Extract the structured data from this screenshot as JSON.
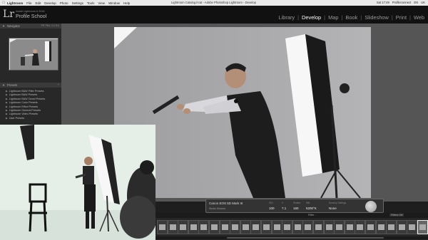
{
  "menubar": {
    "apple_icon": "apple-icon",
    "app_name": "Lightroom",
    "menus": [
      "File",
      "Edit",
      "Develop",
      "Photo",
      "Settings",
      "Tools",
      "View",
      "Window",
      "Help"
    ],
    "window_title": "Lightroom Catalog.lrcat - Adobe Photoshop Lightroom - Develop",
    "status": [
      "Sat 17:49",
      "Profileconnect",
      "EN",
      "UK"
    ]
  },
  "lr": {
    "logo": "Lr",
    "catalog": "Install Lightroom 6 2016",
    "identity": "Profile School",
    "modules": [
      "Library",
      "Develop",
      "Map",
      "Book",
      "Slideshow",
      "Print",
      "Web"
    ],
    "active_module": "Develop"
  },
  "left_panel": {
    "navigator_title": "Navigator",
    "zoom_options": [
      "FIT",
      "FILL",
      "1:1",
      "3:1"
    ],
    "presets_title": "Presets",
    "presets": [
      "Lightroom B&W Filter Presets",
      "Lightroom B&W Presets",
      "Lightroom B&W Toned Presets",
      "Lightroom Color Presets",
      "Lightroom Effect Presets",
      "Lightroom General Presets",
      "Lightroom Video Presets",
      "User Presets"
    ]
  },
  "info_overlay": {
    "camera": "Canon EOS 5D Mark III",
    "lens": "Studio Session",
    "labels": [
      "ISO",
      "f/",
      "Shutter",
      "WB"
    ],
    "values": [
      "100",
      "7.1",
      "160",
      "5200°K"
    ],
    "shoot_label": "Develop Settings",
    "shoot_value": "None"
  },
  "filmstrip": {
    "toggle": "Filter :",
    "filter_label": "Filters Off",
    "thumb_count": 26,
    "selected_index": 25
  }
}
